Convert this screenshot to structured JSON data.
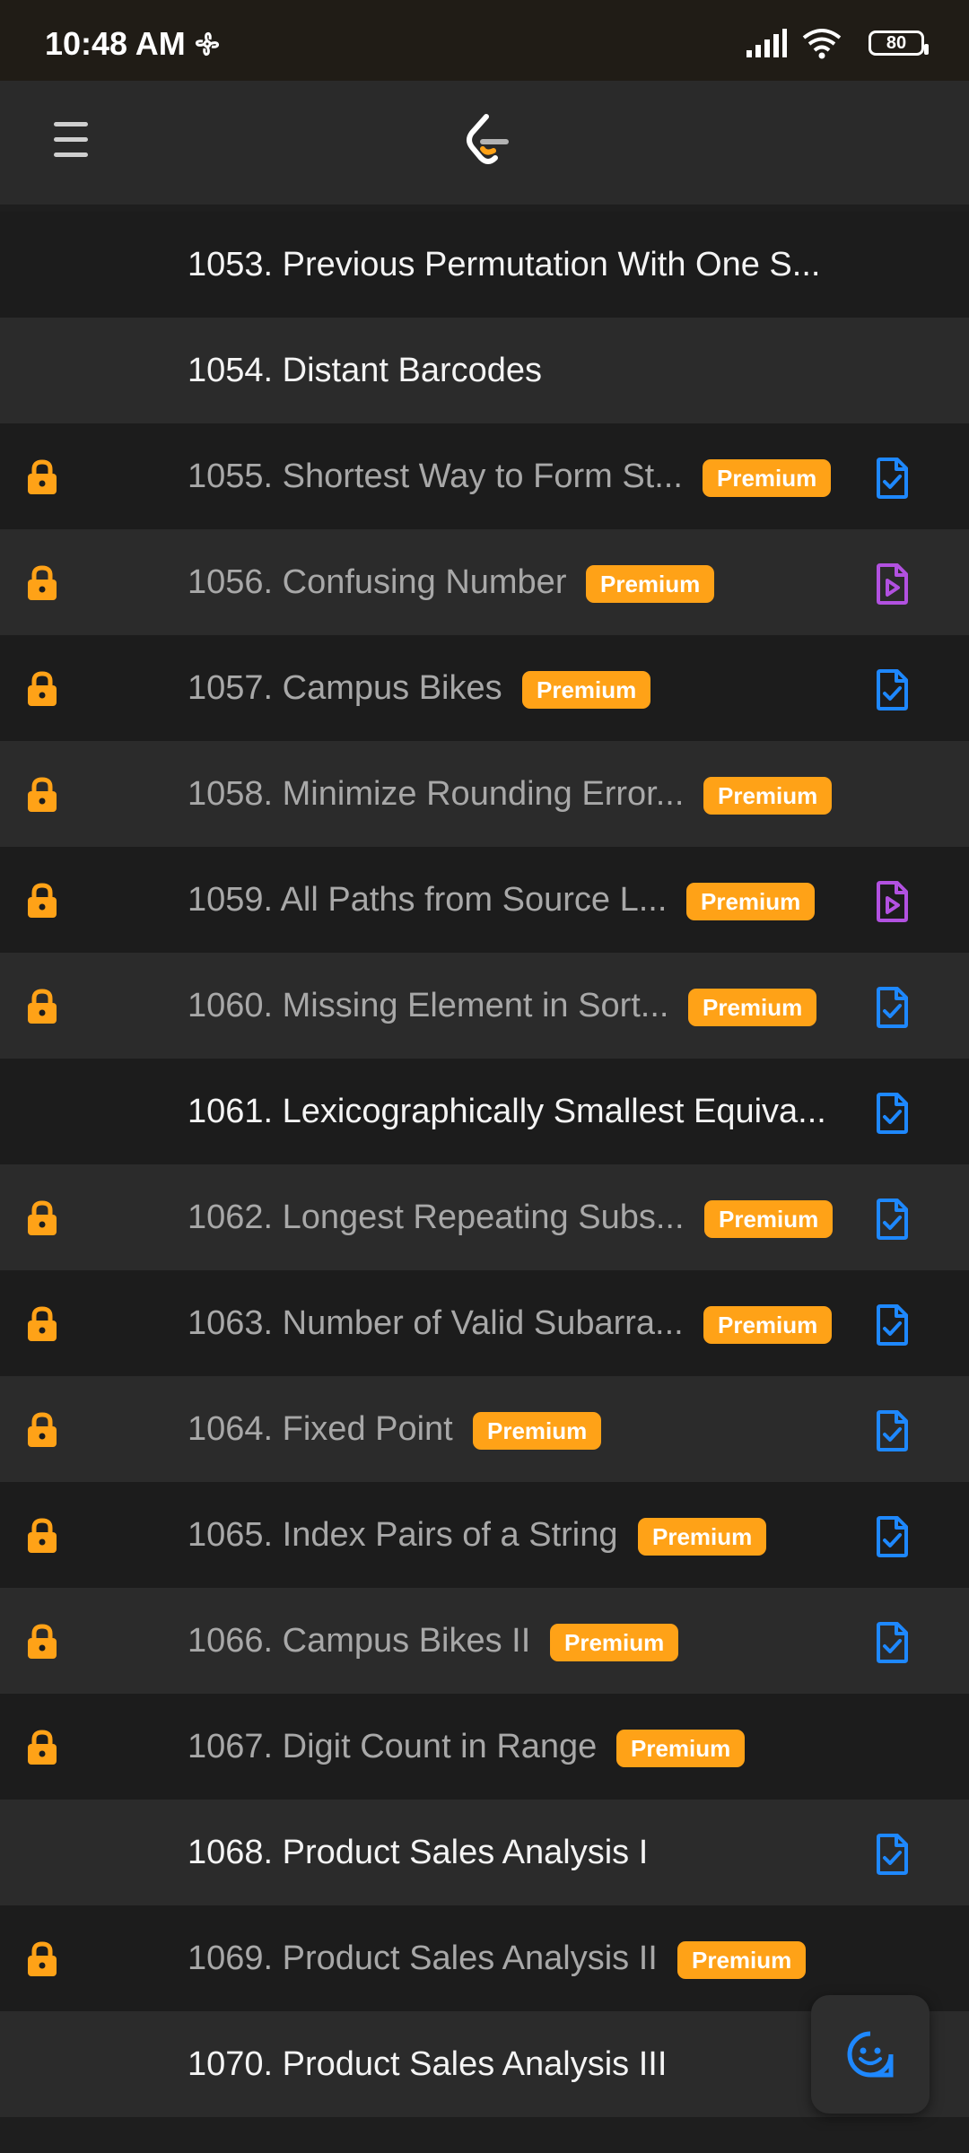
{
  "status_bar": {
    "time": "10:48 AM",
    "battery": "80"
  },
  "colors": {
    "accent": "#ffa217",
    "solution_blue": "#1e88ff",
    "video_purple": "#b251e0"
  },
  "problems": [
    {
      "title": "1053. Previous Permutation With One S...",
      "locked": false,
      "premium": false,
      "icon": "none"
    },
    {
      "title": "1054. Distant Barcodes",
      "locked": false,
      "premium": false,
      "icon": "none"
    },
    {
      "title": "1055. Shortest Way to Form St...",
      "locked": true,
      "premium": true,
      "premium_label": "Premium",
      "icon": "solution-icon"
    },
    {
      "title": "1056. Confusing Number",
      "locked": true,
      "premium": true,
      "premium_label": "Premium",
      "icon": "video-icon"
    },
    {
      "title": "1057. Campus Bikes",
      "locked": true,
      "premium": true,
      "premium_label": "Premium",
      "icon": "solution-icon"
    },
    {
      "title": "1058. Minimize Rounding Error...",
      "locked": true,
      "premium": true,
      "premium_label": "Premium",
      "icon": "none"
    },
    {
      "title": "1059. All Paths from Source L...",
      "locked": true,
      "premium": true,
      "premium_label": "Premium",
      "icon": "video-icon"
    },
    {
      "title": "1060. Missing Element in Sort...",
      "locked": true,
      "premium": true,
      "premium_label": "Premium",
      "icon": "solution-icon"
    },
    {
      "title": "1061. Lexicographically Smallest Equiva...",
      "locked": false,
      "premium": false,
      "icon": "solution-icon"
    },
    {
      "title": "1062. Longest Repeating Subs...",
      "locked": true,
      "premium": true,
      "premium_label": "Premium",
      "icon": "solution-icon"
    },
    {
      "title": "1063. Number of Valid Subarra...",
      "locked": true,
      "premium": true,
      "premium_label": "Premium",
      "icon": "solution-icon"
    },
    {
      "title": "1064. Fixed Point",
      "locked": true,
      "premium": true,
      "premium_label": "Premium",
      "icon": "solution-icon"
    },
    {
      "title": "1065. Index Pairs of a String",
      "locked": true,
      "premium": true,
      "premium_label": "Premium",
      "icon": "solution-icon"
    },
    {
      "title": "1066. Campus Bikes II",
      "locked": true,
      "premium": true,
      "premium_label": "Premium",
      "icon": "solution-icon"
    },
    {
      "title": "1067. Digit Count in Range",
      "locked": true,
      "premium": true,
      "premium_label": "Premium",
      "icon": "none"
    },
    {
      "title": "1068. Product Sales Analysis I",
      "locked": false,
      "premium": false,
      "icon": "solution-icon"
    },
    {
      "title": "1069. Product Sales Analysis II",
      "locked": true,
      "premium": true,
      "premium_label": "Premium",
      "icon": "none"
    },
    {
      "title": "1070. Product Sales Analysis III",
      "locked": false,
      "premium": false,
      "icon": "none"
    }
  ]
}
